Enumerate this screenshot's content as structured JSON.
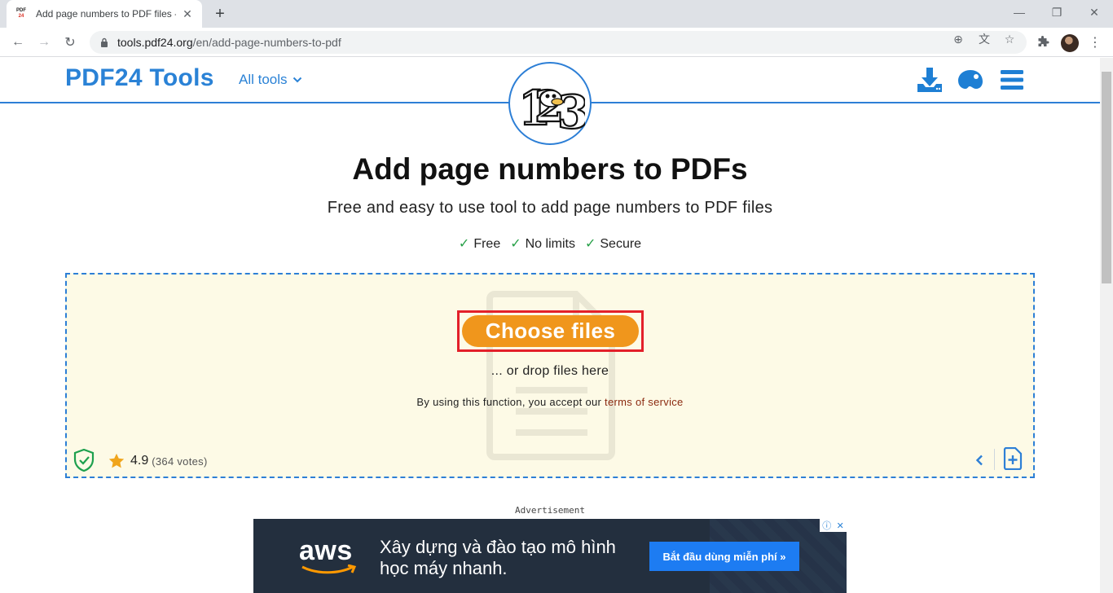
{
  "browser": {
    "tab": {
      "favicon_top": "PDF",
      "favicon_bottom": "24",
      "title": "Add page numbers to PDF files -",
      "close_glyph": "✕"
    },
    "new_tab_glyph": "+",
    "window_controls": {
      "minimize": "—",
      "restore": "❐",
      "close": "✕"
    },
    "nav": {
      "back": "←",
      "forward": "→",
      "reload": "↻"
    },
    "address": {
      "host": "tools.pdf24.org",
      "path": "/en/add-page-numbers-to-pdf"
    },
    "omnibox_icons": {
      "add": "⊕",
      "translate": "文",
      "bookmark": "☆"
    },
    "toolbar_icons": {
      "extensions": "🧩",
      "menu": "⋮"
    }
  },
  "header": {
    "brand": "PDF24 Tools",
    "all_tools": "All tools",
    "chevron": "⌄",
    "icons": [
      "download-icon",
      "palette-icon",
      "hamburger-menu-icon"
    ]
  },
  "hero": {
    "title": "Add page numbers to PDFs",
    "subtitle": "Free and easy to use tool to add page numbers to PDF files",
    "features": [
      {
        "check": "✓",
        "label": "Free"
      },
      {
        "check": "✓",
        "label": "No limits"
      },
      {
        "check": "✓",
        "label": "Secure"
      }
    ]
  },
  "dropzone": {
    "choose_button": "Choose files",
    "drop_text": "... or drop files here",
    "terms_prefix": "By using this function, you accept our ",
    "terms_link": "terms of service",
    "rating_value": "4.9",
    "rating_votes": "(364 votes)",
    "left_arrow": "‹"
  },
  "ad": {
    "label": "Advertisement",
    "brand": "aws",
    "text": "Xây dựng và đào tạo mô hình học máy nhanh.",
    "cta": "Bắt đầu dùng miễn phí »",
    "info": "ⓘ",
    "close": "✕"
  },
  "colors": {
    "brand_blue": "#2a82d6",
    "cta_orange": "#f0961c",
    "highlight_red": "#e3202a",
    "dropzone_bg": "#fdfae6",
    "check_green": "#27a048"
  }
}
